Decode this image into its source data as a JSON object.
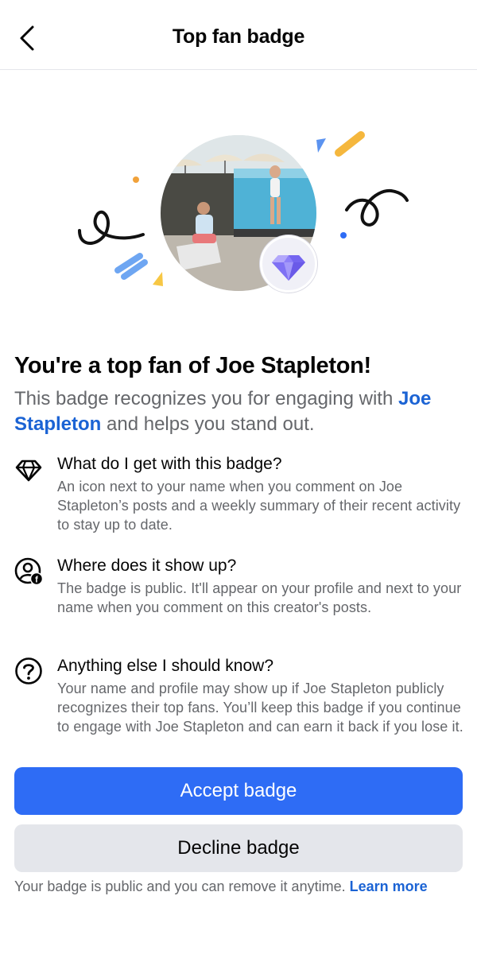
{
  "header": {
    "title": "Top fan badge"
  },
  "hero": {
    "badge_icon": "diamond-icon"
  },
  "headline": "You're a top fan of Joe Stapleton!",
  "intro": {
    "text_before": "This badge recognizes you for engaging with ",
    "link_name": "Joe Stapleton",
    "text_after": " and helps you stand out."
  },
  "info": [
    {
      "icon": "diamond-outline-icon",
      "title": "What do I get with this badge?",
      "body": "An icon next to your name when you comment on Joe Stapleton’s posts and a weekly summary of their recent activity to stay up to date."
    },
    {
      "icon": "profile-facebook-icon",
      "title": "Where does it show up?",
      "body": "The badge is public. It'll appear on your profile and next to your name when you comment on this creator's posts."
    },
    {
      "icon": "question-icon",
      "title": "Anything else I should know?",
      "body": "Your name and profile may show up if Joe Stapleton publicly recognizes their top fans. You’ll keep this badge if you continue to engage with Joe Stapleton and can earn it back if you lose it."
    }
  ],
  "actions": {
    "accept_label": "Accept badge",
    "decline_label": "Decline badge"
  },
  "footer": {
    "note": "Your badge is public and you can remove it anytime.",
    "learn_more": "Learn more"
  },
  "colors": {
    "primary": "#2e6cf5",
    "link": "#1b63d4",
    "secondary_text": "#65676b",
    "badge_purple": "#7b6cf6"
  }
}
